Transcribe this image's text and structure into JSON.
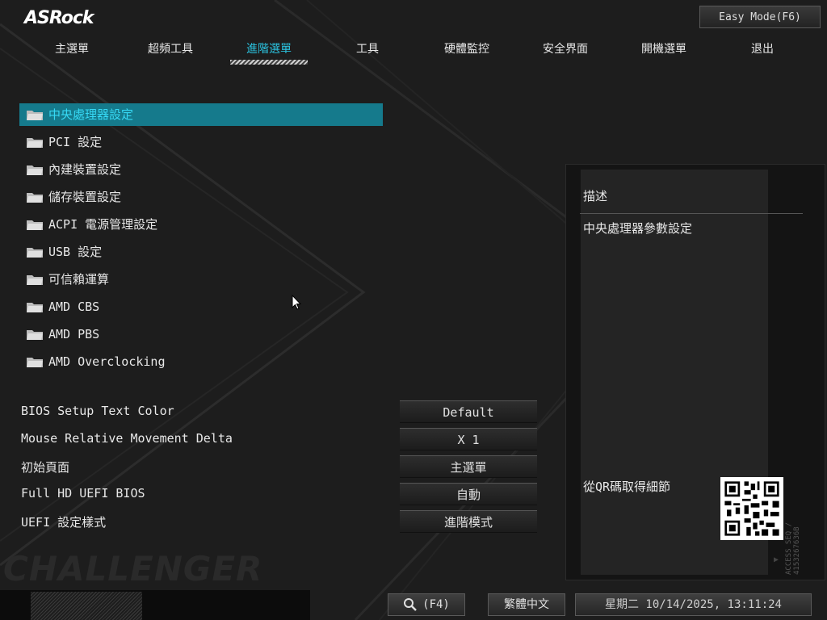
{
  "brand": {
    "logo_text": "ASRock"
  },
  "header": {
    "easy_mode_label": "Easy Mode(F6)"
  },
  "menu": {
    "items": [
      {
        "label": "主選單"
      },
      {
        "label": "超頻工具"
      },
      {
        "label": "進階選單",
        "active": true
      },
      {
        "label": "工具"
      },
      {
        "label": "硬體監控"
      },
      {
        "label": "安全界面"
      },
      {
        "label": "開機選單"
      },
      {
        "label": "退出"
      }
    ]
  },
  "submenus": [
    {
      "label": "中央處理器設定",
      "selected": true
    },
    {
      "label": "PCI 設定"
    },
    {
      "label": "內建裝置設定"
    },
    {
      "label": "儲存裝置設定"
    },
    {
      "label": "ACPI 電源管理設定"
    },
    {
      "label": "USB 設定"
    },
    {
      "label": "可信賴運算"
    },
    {
      "label": "AMD CBS"
    },
    {
      "label": "AMD PBS"
    },
    {
      "label": "AMD Overclocking"
    }
  ],
  "settings": [
    {
      "label": "BIOS Setup Text Color",
      "value": "Default"
    },
    {
      "label": "Mouse Relative Movement Delta",
      "value": "X 1"
    },
    {
      "label": "初始頁面",
      "value": "主選單"
    },
    {
      "label": "Full HD UEFI BIOS",
      "value": "自動"
    },
    {
      "label": "UEFI 設定樣式",
      "value": "進階模式"
    }
  ],
  "description": {
    "title": "描述",
    "text": "中央處理器參數設定",
    "qr_label": "從QR碼取得細節",
    "side_text": "ACCESS SEQ / 4153267636B"
  },
  "watermark": {
    "text": "CHALLENGER"
  },
  "bottom": {
    "search_label": "(F4)",
    "language": "繁體中文",
    "clock": "星期二 10/14/2025, 13:11:24"
  },
  "colors": {
    "accent": "#2bc3e0",
    "selected_bg": "#157a8c",
    "background": "#1d1d1d"
  },
  "icons": {
    "folder": "folder-icon",
    "search": "search-icon",
    "cursor": "mouse-cursor-icon"
  }
}
